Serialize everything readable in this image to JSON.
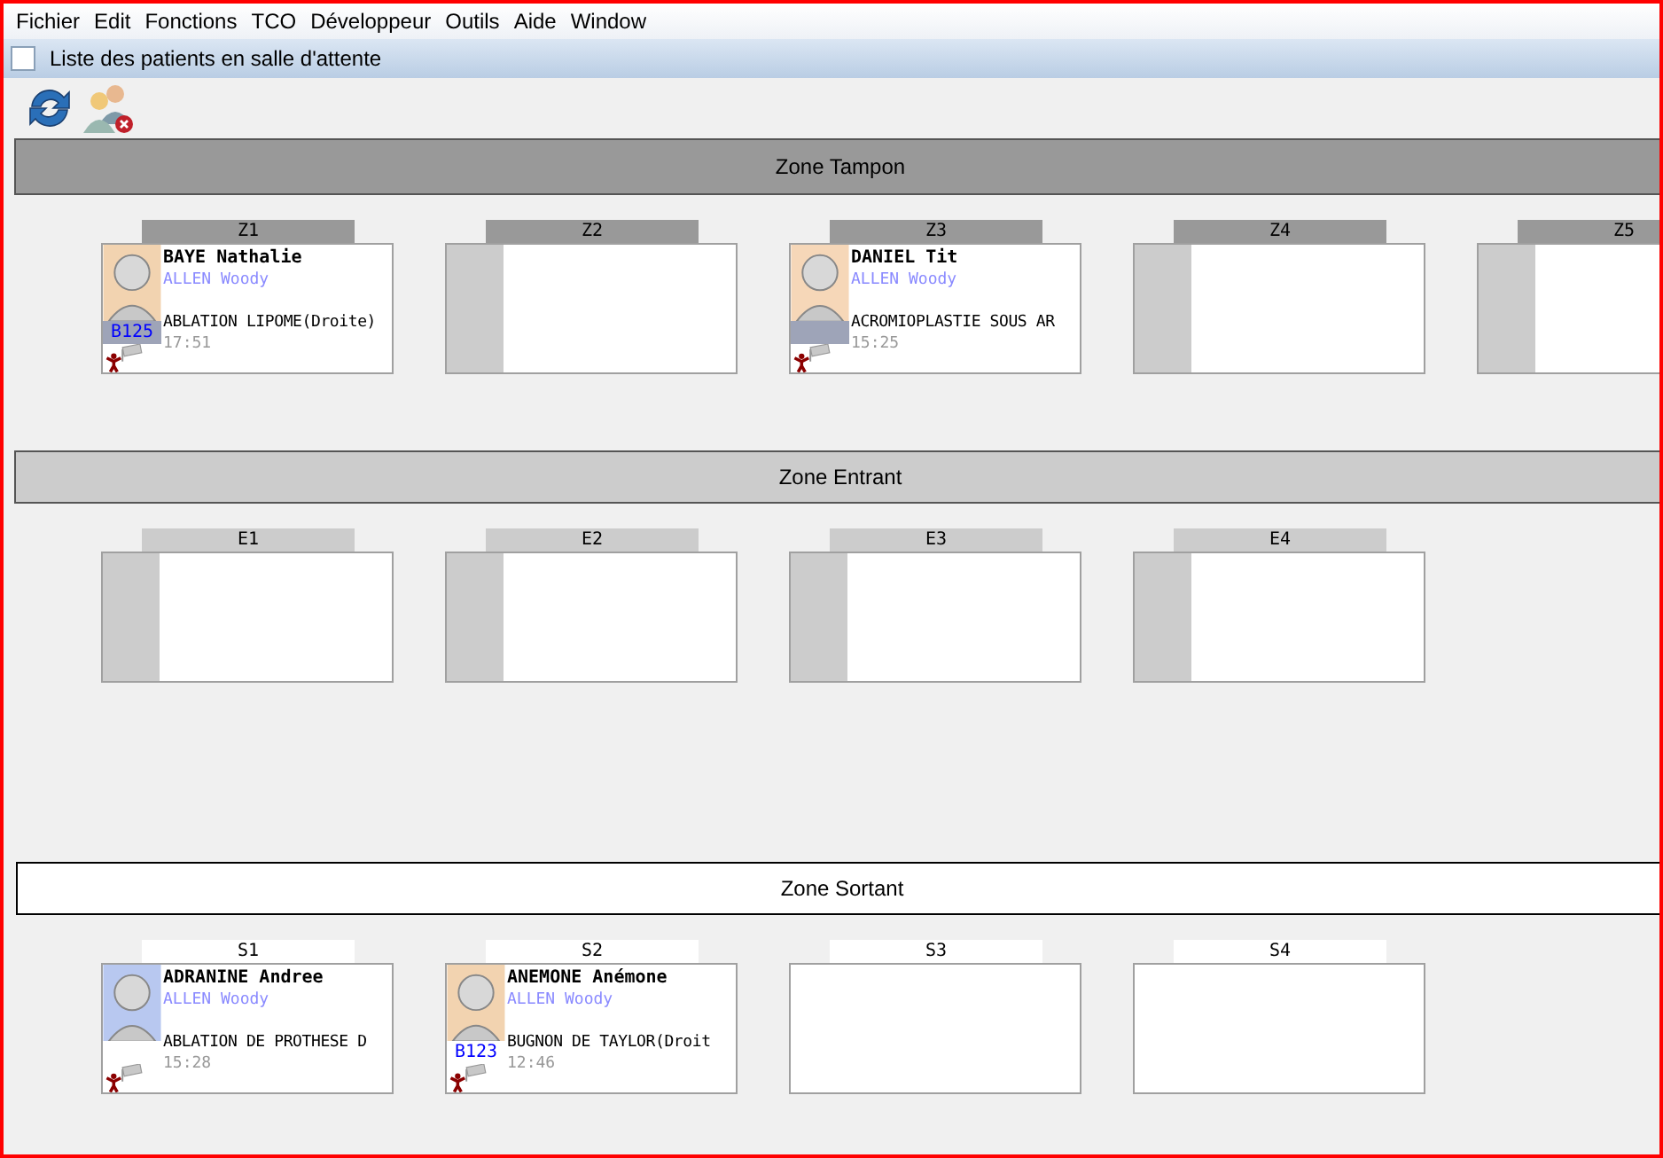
{
  "menu": [
    "Fichier",
    "Edit",
    "Fonctions",
    "TCO",
    "Développeur",
    "Outils",
    "Aide",
    "Window"
  ],
  "waiting_list": {
    "label": "Liste des patients en salle d'attente",
    "checked": false
  },
  "zones": [
    {
      "title": "Zone Tampon",
      "kind": "buffer",
      "slots": [
        {
          "label": "Z1",
          "patient": {
            "name": "BAYE Nathalie",
            "doctor": "ALLEN Woody",
            "procedure": "ABLATION LIPOME(Droite)",
            "time": "17:51",
            "room": "B125",
            "room_highlight": true
          }
        },
        {
          "label": "Z2"
        },
        {
          "label": "Z3",
          "patient": {
            "name": "DANIEL Tit",
            "doctor": "ALLEN Woody",
            "procedure": "ACROMIOPLASTIE SOUS AR",
            "time": "15:25",
            "room_highlight": true
          }
        },
        {
          "label": "Z4"
        },
        {
          "label": "Z5"
        }
      ]
    },
    {
      "title": "Zone Entrant",
      "kind": "incoming",
      "slots": [
        {
          "label": "E1"
        },
        {
          "label": "E2"
        },
        {
          "label": "E3"
        },
        {
          "label": "E4"
        }
      ]
    },
    {
      "title": "Zone Sortant",
      "kind": "outgoing",
      "slots": [
        {
          "label": "S1",
          "patient": {
            "name": "ADRANINE Andree",
            "doctor": "ALLEN Woody",
            "procedure": "ABLATION DE PROTHESE D",
            "time": "15:28",
            "room_highlight": false
          }
        },
        {
          "label": "S2",
          "patient": {
            "name": "ANEMONE Anémone",
            "doctor": "ALLEN Woody",
            "procedure": "BUGNON DE TAYLOR(Droit",
            "time": "12:46",
            "room": "B123",
            "room_highlight": false
          }
        },
        {
          "label": "S3"
        },
        {
          "label": "S4"
        }
      ]
    }
  ]
}
